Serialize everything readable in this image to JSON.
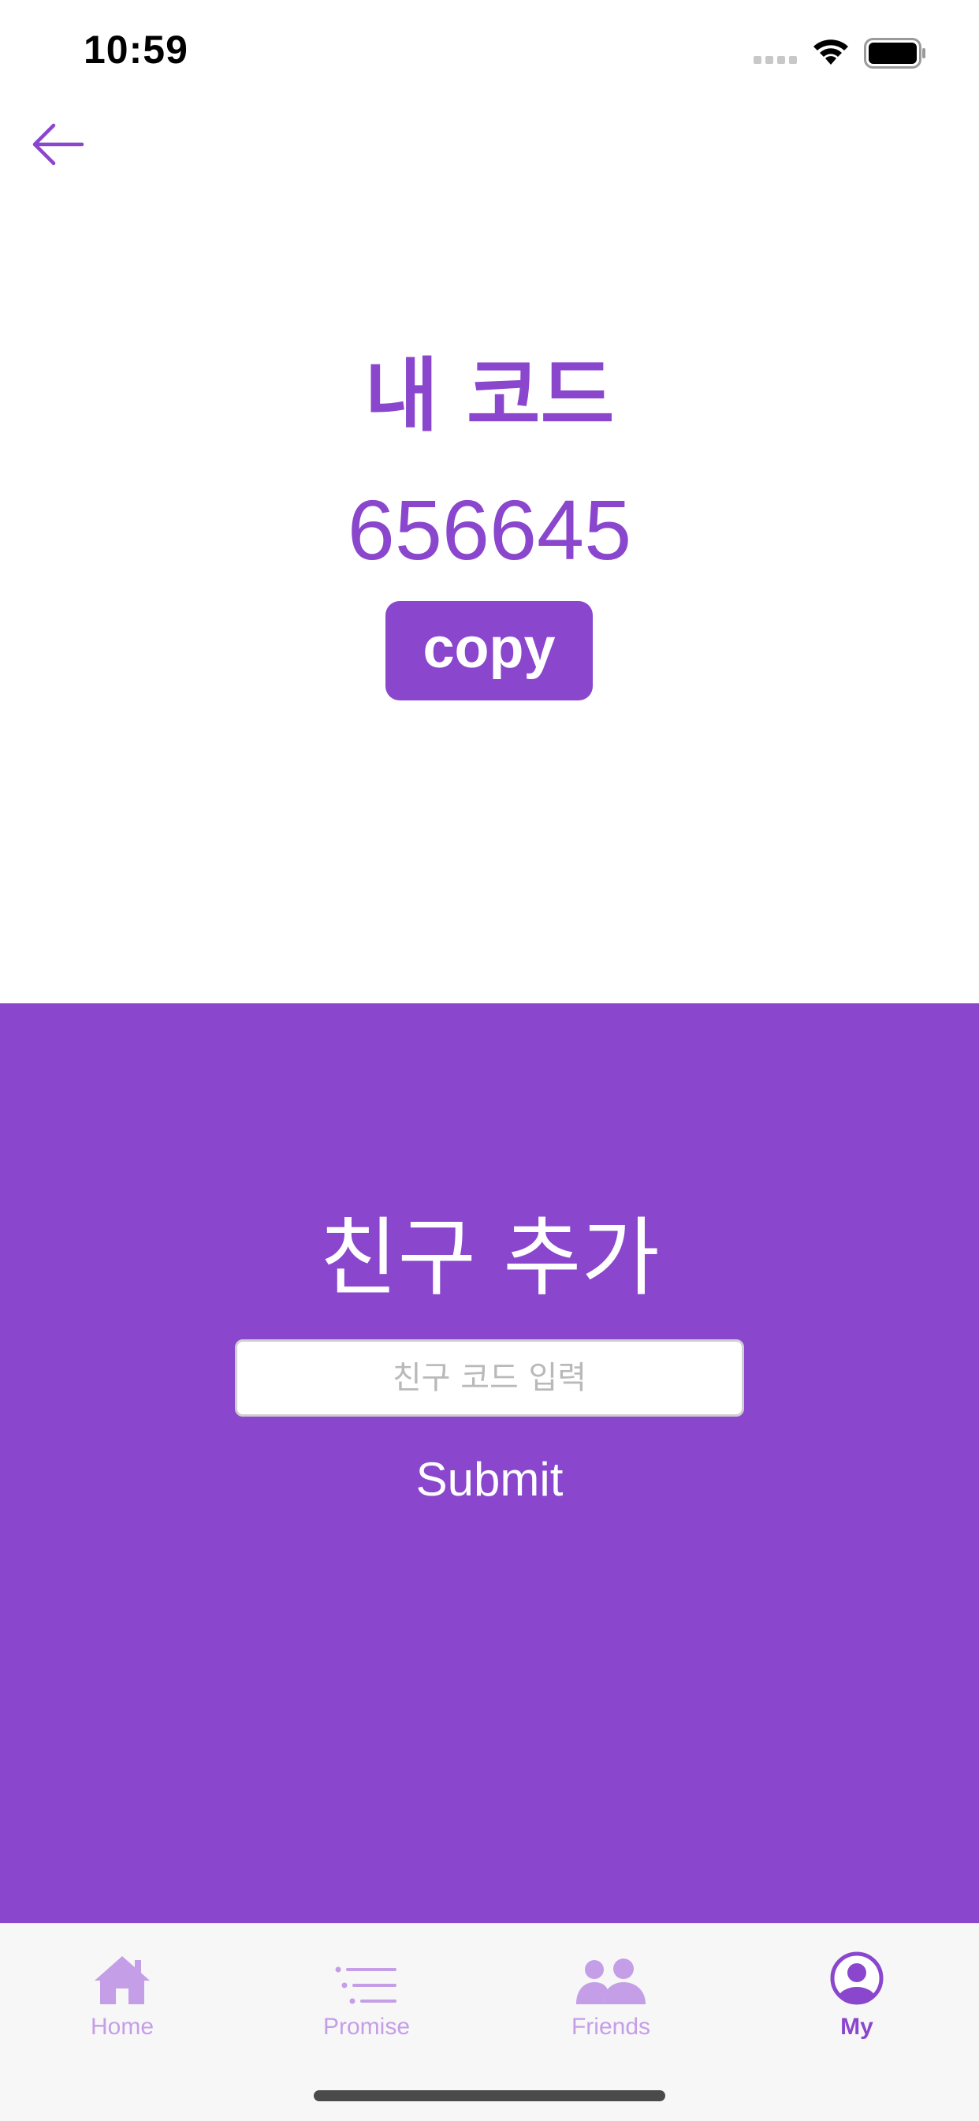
{
  "status_bar": {
    "time": "10:59",
    "icons": [
      "signal-icon",
      "wifi-icon",
      "battery-icon"
    ]
  },
  "nav": {
    "back_icon": "arrow-left-icon"
  },
  "my_code": {
    "title": "내 코드",
    "value": "656645",
    "copy_label": "copy"
  },
  "add_friend": {
    "title": "친구 추가",
    "input_placeholder": "친구 코드 입력",
    "input_value": "",
    "submit_label": "Submit"
  },
  "tabs": [
    {
      "label": "Home",
      "icon": "home-icon",
      "active": false
    },
    {
      "label": "Promise",
      "icon": "list-icon",
      "active": false
    },
    {
      "label": "Friends",
      "icon": "people-icon",
      "active": false
    },
    {
      "label": "My",
      "icon": "person-circle-icon",
      "active": true
    }
  ],
  "colors": {
    "accent": "#8a46cd",
    "accent_light": "#c59ee8",
    "background": "#ffffff",
    "tab_bar_background": "#f7f7f7"
  }
}
